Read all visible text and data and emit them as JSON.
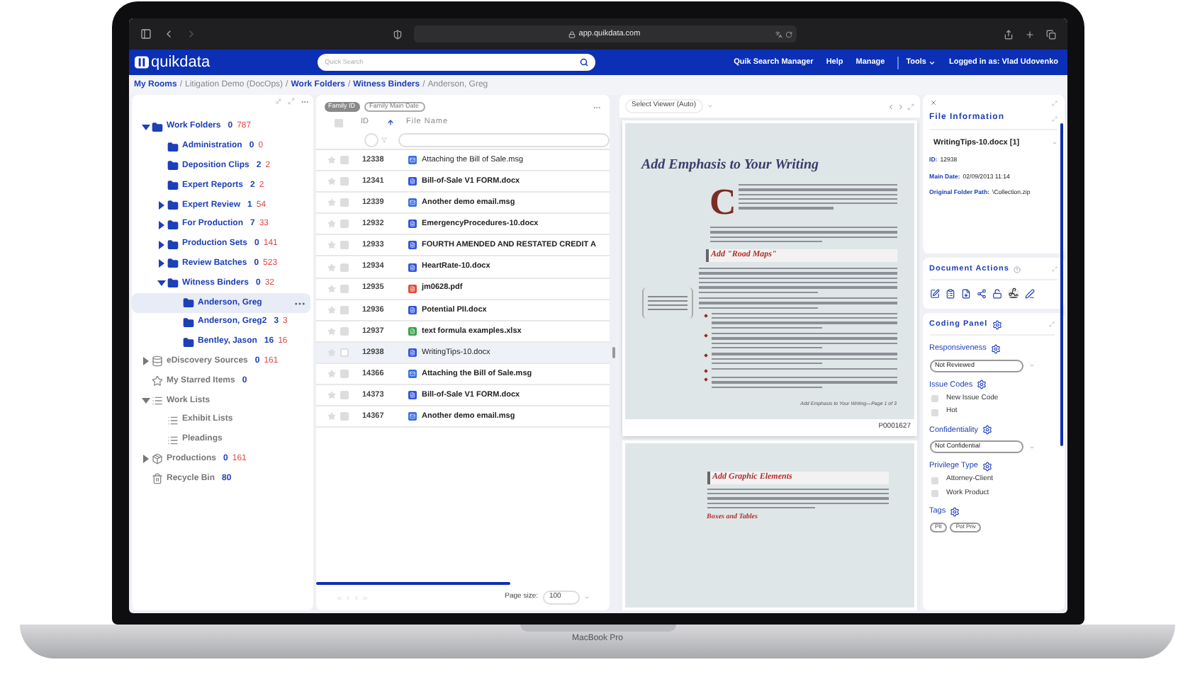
{
  "browser": {
    "url": "app.quikdata.com"
  },
  "header": {
    "logo": "quikdata",
    "search_placeholder": "Quick Search",
    "nav": [
      {
        "label": "Quik Search Manager",
        "kind": "link"
      },
      {
        "label": "Help",
        "kind": "link"
      },
      {
        "label": "Manage",
        "kind": "link"
      },
      {
        "label": "Tools",
        "kind": "menu"
      }
    ],
    "user": "Logged in as: Vlad Udovenko"
  },
  "breadcrumb_separator": "/",
  "breadcrumb": [
    {
      "label": "My Rooms",
      "link": true
    },
    {
      "label": "Litigation Demo (DocOps)",
      "link": false
    },
    {
      "label": "Work Folders",
      "link": true
    },
    {
      "label": "Witness Binders",
      "link": true
    },
    {
      "label": "Anderson, Greg",
      "link": false
    }
  ],
  "tree": [
    {
      "label": "Work Folders",
      "kind": "folder",
      "count": "0",
      "total": "787",
      "expanded": true,
      "selected": false,
      "children": [
        {
          "label": "Administration",
          "kind": "folder",
          "count": "0",
          "total": "0",
          "selected": false
        },
        {
          "label": "Deposition Clips",
          "kind": "folder",
          "count": "2",
          "total": "2",
          "selected": false
        },
        {
          "label": "Expert Reports",
          "kind": "folder",
          "count": "2",
          "total": "2",
          "selected": false
        },
        {
          "label": "Expert Review",
          "kind": "folder",
          "count": "1",
          "total": "54",
          "expanded": false,
          "selected": false
        },
        {
          "label": "For Production",
          "kind": "folder",
          "count": "7",
          "total": "33",
          "expanded": false,
          "selected": false
        },
        {
          "label": "Production Sets",
          "kind": "folder",
          "count": "0",
          "total": "141",
          "expanded": false,
          "selected": false
        },
        {
          "label": "Review Batches",
          "kind": "folder",
          "count": "0",
          "total": "523",
          "expanded": false,
          "selected": false
        },
        {
          "label": "Witness Binders",
          "kind": "folder",
          "count": "0",
          "total": "32",
          "expanded": true,
          "selected": false,
          "children": [
            {
              "label": "Anderson, Greg",
              "kind": "folder",
              "selected": true
            },
            {
              "label": "Anderson, Greg2",
              "kind": "folder",
              "count": "3",
              "total": "3",
              "selected": false
            },
            {
              "label": "Bentley, Jason",
              "kind": "folder",
              "count": "16",
              "total": "16",
              "selected": false
            }
          ]
        }
      ]
    },
    {
      "label": "eDiscovery Sources",
      "kind": "database",
      "count": "0",
      "total": "161",
      "expanded": false,
      "selected": false
    },
    {
      "label": "My Starred Items",
      "kind": "star",
      "count": "0",
      "selected": false
    },
    {
      "label": "Work Lists",
      "kind": "list",
      "expanded": true,
      "selected": false,
      "children": [
        {
          "label": "Exhibit Lists",
          "kind": "list",
          "selected": false
        },
        {
          "label": "Pleadings",
          "kind": "list",
          "selected": false
        }
      ]
    },
    {
      "label": "Productions",
      "kind": "production",
      "count": "0",
      "total": "161",
      "expanded": false,
      "selected": false
    },
    {
      "label": "Recycle Bin",
      "kind": "trash",
      "count": "80",
      "selected": false
    }
  ],
  "file_list": {
    "sort_chips": [
      {
        "label": "Family ID",
        "selected": true
      },
      {
        "label": "Family Main Date",
        "selected": false
      }
    ],
    "columns": [
      "ID",
      "File Name"
    ],
    "all_checked": false,
    "rows": [
      {
        "id": "12338",
        "name": "Attaching the Bill of Sale.msg",
        "kind": "msg",
        "read": true,
        "starred": false,
        "checked": false,
        "selected": false
      },
      {
        "id": "12341",
        "name": "Bill-of-Sale V1 FORM.docx",
        "kind": "docx",
        "read": false,
        "starred": false,
        "checked": false,
        "selected": false
      },
      {
        "id": "12339",
        "name": "Another demo email.msg",
        "kind": "msg",
        "read": false,
        "starred": false,
        "checked": false,
        "selected": false
      },
      {
        "id": "12932",
        "name": "EmergencyProcedures-10.docx",
        "kind": "docx",
        "read": false,
        "starred": false,
        "checked": false,
        "selected": false
      },
      {
        "id": "12933",
        "name": "FOURTH AMENDED AND RESTATED CREDIT A",
        "kind": "docx",
        "read": false,
        "starred": false,
        "checked": false,
        "selected": false
      },
      {
        "id": "12934",
        "name": "HeartRate-10.docx",
        "kind": "docx",
        "read": false,
        "starred": false,
        "checked": false,
        "selected": false
      },
      {
        "id": "12935",
        "name": "jm0628.pdf",
        "kind": "pdf",
        "read": false,
        "starred": false,
        "checked": false,
        "selected": false
      },
      {
        "id": "12936",
        "name": "Potential PII.docx",
        "kind": "docx",
        "read": false,
        "starred": false,
        "checked": false,
        "selected": false
      },
      {
        "id": "12937",
        "name": "text formula examples.xlsx",
        "kind": "xlsx",
        "read": false,
        "starred": false,
        "checked": false,
        "selected": false
      },
      {
        "id": "12938",
        "name": "WritingTips-10.docx",
        "kind": "docx",
        "read": true,
        "starred": false,
        "checked": false,
        "selected": true
      },
      {
        "id": "14366",
        "name": "Attaching the Bill of Sale.msg",
        "kind": "msg",
        "read": false,
        "starred": false,
        "checked": false,
        "selected": false
      },
      {
        "id": "14373",
        "name": "Bill-of-Sale V1 FORM.docx",
        "kind": "docx",
        "read": false,
        "starred": false,
        "checked": false,
        "selected": false
      },
      {
        "id": "14367",
        "name": "Another demo email.msg",
        "kind": "msg",
        "read": false,
        "starred": false,
        "checked": false,
        "selected": false
      }
    ],
    "page_size_label": "Page size:",
    "page_size": "100"
  },
  "viewer": {
    "select": "Select Viewer (Auto)",
    "document": {
      "title": "Add Emphasis to Your Writing",
      "drop_cap": "C",
      "section_heading": "Add \"Road Maps\"",
      "footer": "Add Emphasis to Your Writing—Page 1 of 3",
      "bates": "P0001627",
      "page2_heading": "Add Graphic Elements",
      "page2_subheading": "Boxes and Tables"
    }
  },
  "file_info": {
    "title": "File Information",
    "file": "WritingTips-10.docx [1]",
    "fields": [
      {
        "label": "ID:",
        "value": "12938"
      },
      {
        "label": "Main Date:",
        "value": "02/09/2013 11:14"
      },
      {
        "label": "Original Folder Path:",
        "value": "\\Collection.zip"
      }
    ]
  },
  "document_actions": {
    "title": "Document Actions"
  },
  "coding_panel": {
    "title": "Coding Panel",
    "sections": [
      {
        "label": "Responsiveness",
        "kind": "select",
        "value": "Not Reviewed"
      },
      {
        "label": "Issue Codes",
        "kind": "checkboxes",
        "options": [
          {
            "label": "New Issue Code",
            "checked": false
          },
          {
            "label": "Hot",
            "checked": false
          }
        ]
      },
      {
        "label": "Confidentiality",
        "kind": "select",
        "value": "Not Confidential"
      },
      {
        "label": "Privilege Type",
        "kind": "checkboxes",
        "options": [
          {
            "label": "Attorney-Client",
            "checked": false
          },
          {
            "label": "Work Product",
            "checked": false
          }
        ]
      },
      {
        "label": "Tags",
        "kind": "tags",
        "tags": [
          "PII",
          "Pot Priv"
        ]
      }
    ]
  },
  "device": {
    "label": "MacBook Pro"
  }
}
